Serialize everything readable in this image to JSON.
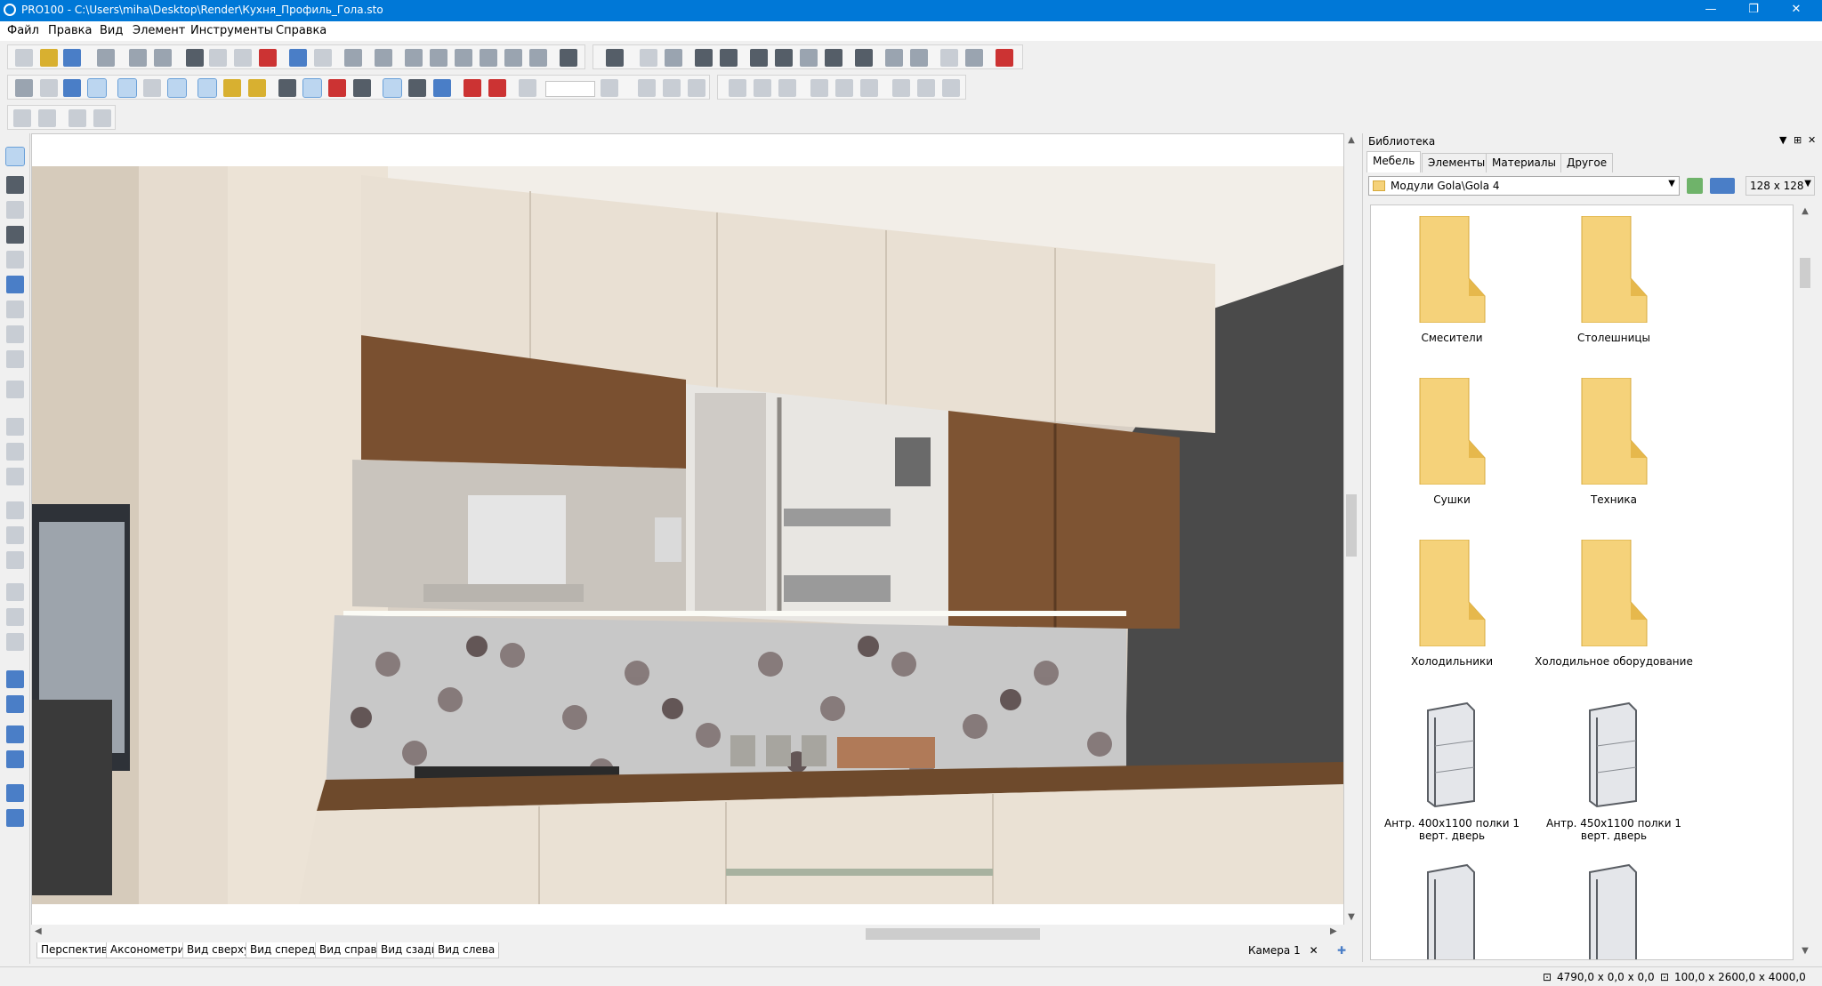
{
  "window": {
    "title": "PRO100 - C:\\Users\\miha\\Desktop\\Render\\Кухня_Профиль_Гола.sto",
    "minimize": "—",
    "maximize": "❐",
    "close": "✕"
  },
  "menu": [
    "Файл",
    "Правка",
    "Вид",
    "Элемент",
    "Инструменты",
    "Справка"
  ],
  "view_tabs": [
    "Перспектива",
    "Аксонометрия",
    "Вид сверху",
    "Вид спереди",
    "Вид справа",
    "Вид сзади",
    "Вид слева"
  ],
  "camera_tab": {
    "label": "Камера 1",
    "close": "✕"
  },
  "library": {
    "title": "Библиотека",
    "tabs": [
      "Мебель",
      "Элементы",
      "Материалы",
      "Другое"
    ],
    "path": "Модули Gola\\Gola 4",
    "thumb_size": "128 x 128",
    "items": [
      {
        "label": "Смесители",
        "icon": "folder-icon"
      },
      {
        "label": "Столешницы",
        "icon": "folder-icon"
      },
      {
        "label": "Сушки",
        "icon": "folder-icon"
      },
      {
        "label": "Техника",
        "icon": "folder-icon"
      },
      {
        "label": "Холодильники",
        "icon": "folder-icon"
      },
      {
        "label": "Холодильное оборудование",
        "icon": "folder-icon"
      },
      {
        "label": "Антр. 400x1100 полки 1 верт. дверь",
        "icon": "cabinet-icon"
      },
      {
        "label": "Антр. 450x1100 полки 1 верт. дверь",
        "icon": "cabinet-icon"
      },
      {
        "label": "",
        "icon": "cabinet-icon"
      },
      {
        "label": "",
        "icon": "cabinet-icon"
      }
    ]
  },
  "status": {
    "position": "4790,0 x 0,0 x 0,0",
    "size": "100,0 x 2600,0 x 4000,0"
  },
  "colors": {
    "titlebar": "#0078d7",
    "wood": "#7a5030",
    "cabinet_cream": "#e8dccd",
    "wall_dark": "#4a4a4a",
    "folder": "#f5d27a"
  }
}
